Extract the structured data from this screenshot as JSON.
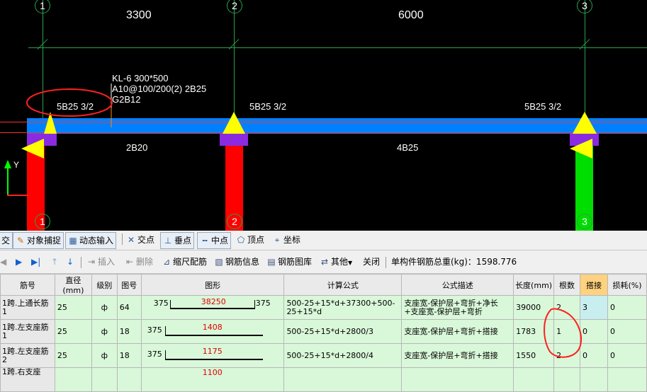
{
  "drawing": {
    "axis_numbers": [
      "1",
      "2",
      "3"
    ],
    "spans": [
      "3300",
      "6000"
    ],
    "beam_label": [
      "KL-6 300*500",
      "A10@100/200(2) 2B25",
      "G2B12"
    ],
    "top_rebar_labels": [
      "5B25 3/2",
      "5B25 3/2",
      "5B25 3/2"
    ],
    "bottom_rebar_labels": [
      "2B20",
      "4B25"
    ],
    "ucs_y": "Y"
  },
  "snap_toolbar": {
    "items": [
      "交",
      "对象捕捉",
      "动态输入",
      "交点",
      "垂点",
      "中点",
      "顶点",
      "坐标"
    ]
  },
  "edit_toolbar": {
    "insert": "插入",
    "delete": "删除",
    "scale_rebar": "缩尺配筋",
    "rebar_info": "钢筋信息",
    "rebar_library": "钢筋图库",
    "other": "其他",
    "close": "关闭",
    "total_weight": "单构件钢筋总重(kg)：1598.776"
  },
  "table": {
    "headers": [
      "筋号",
      "直径(mm)",
      "级别",
      "图号",
      "图形",
      "计算公式",
      "公式描述",
      "长度(mm)",
      "根数",
      "搭接",
      "损耗(%)"
    ],
    "rows": [
      {
        "name": "1跨.上通长筋1",
        "dia": "25",
        "grade": "ф",
        "fig": "64",
        "left": "375",
        "mid": "38250",
        "right": "375",
        "formula": "500-25+15*d+37300+500-25+15*d",
        "desc": "支座宽-保护层+弯折+净长+支座宽-保护层+弯折",
        "length": "39000",
        "count": "2",
        "lap": "3",
        "loss": "0"
      },
      {
        "name": "1跨.左支座筋1",
        "dia": "25",
        "grade": "ф",
        "fig": "18",
        "left": "375",
        "mid": "1408",
        "right": "",
        "formula": "500-25+15*d+2800/3",
        "desc": "支座宽-保护层+弯折+搭接",
        "length": "1783",
        "count": "1",
        "lap": "0",
        "loss": "0"
      },
      {
        "name": "1跨.左支座筋2",
        "dia": "25",
        "grade": "ф",
        "fig": "18",
        "left": "375",
        "mid": "1175",
        "right": "",
        "formula": "500-25+15*d+2800/4",
        "desc": "支座宽-保护层+弯折+搭接",
        "length": "1550",
        "count": "2",
        "lap": "0",
        "loss": "0"
      },
      {
        "name": "1跨.右支座",
        "dia": "",
        "grade": "",
        "fig": "",
        "left": "",
        "mid": "1100",
        "right": "",
        "formula": "",
        "desc": "",
        "length": "",
        "count": "",
        "lap": "",
        "loss": ""
      }
    ]
  },
  "colors": {
    "beam": "#0080ff",
    "column": "#ff0000",
    "column_green": "#00dd00",
    "support_cap": "#8a2be2",
    "marker": "#ffff00",
    "grid_line": "#2aa04a"
  }
}
